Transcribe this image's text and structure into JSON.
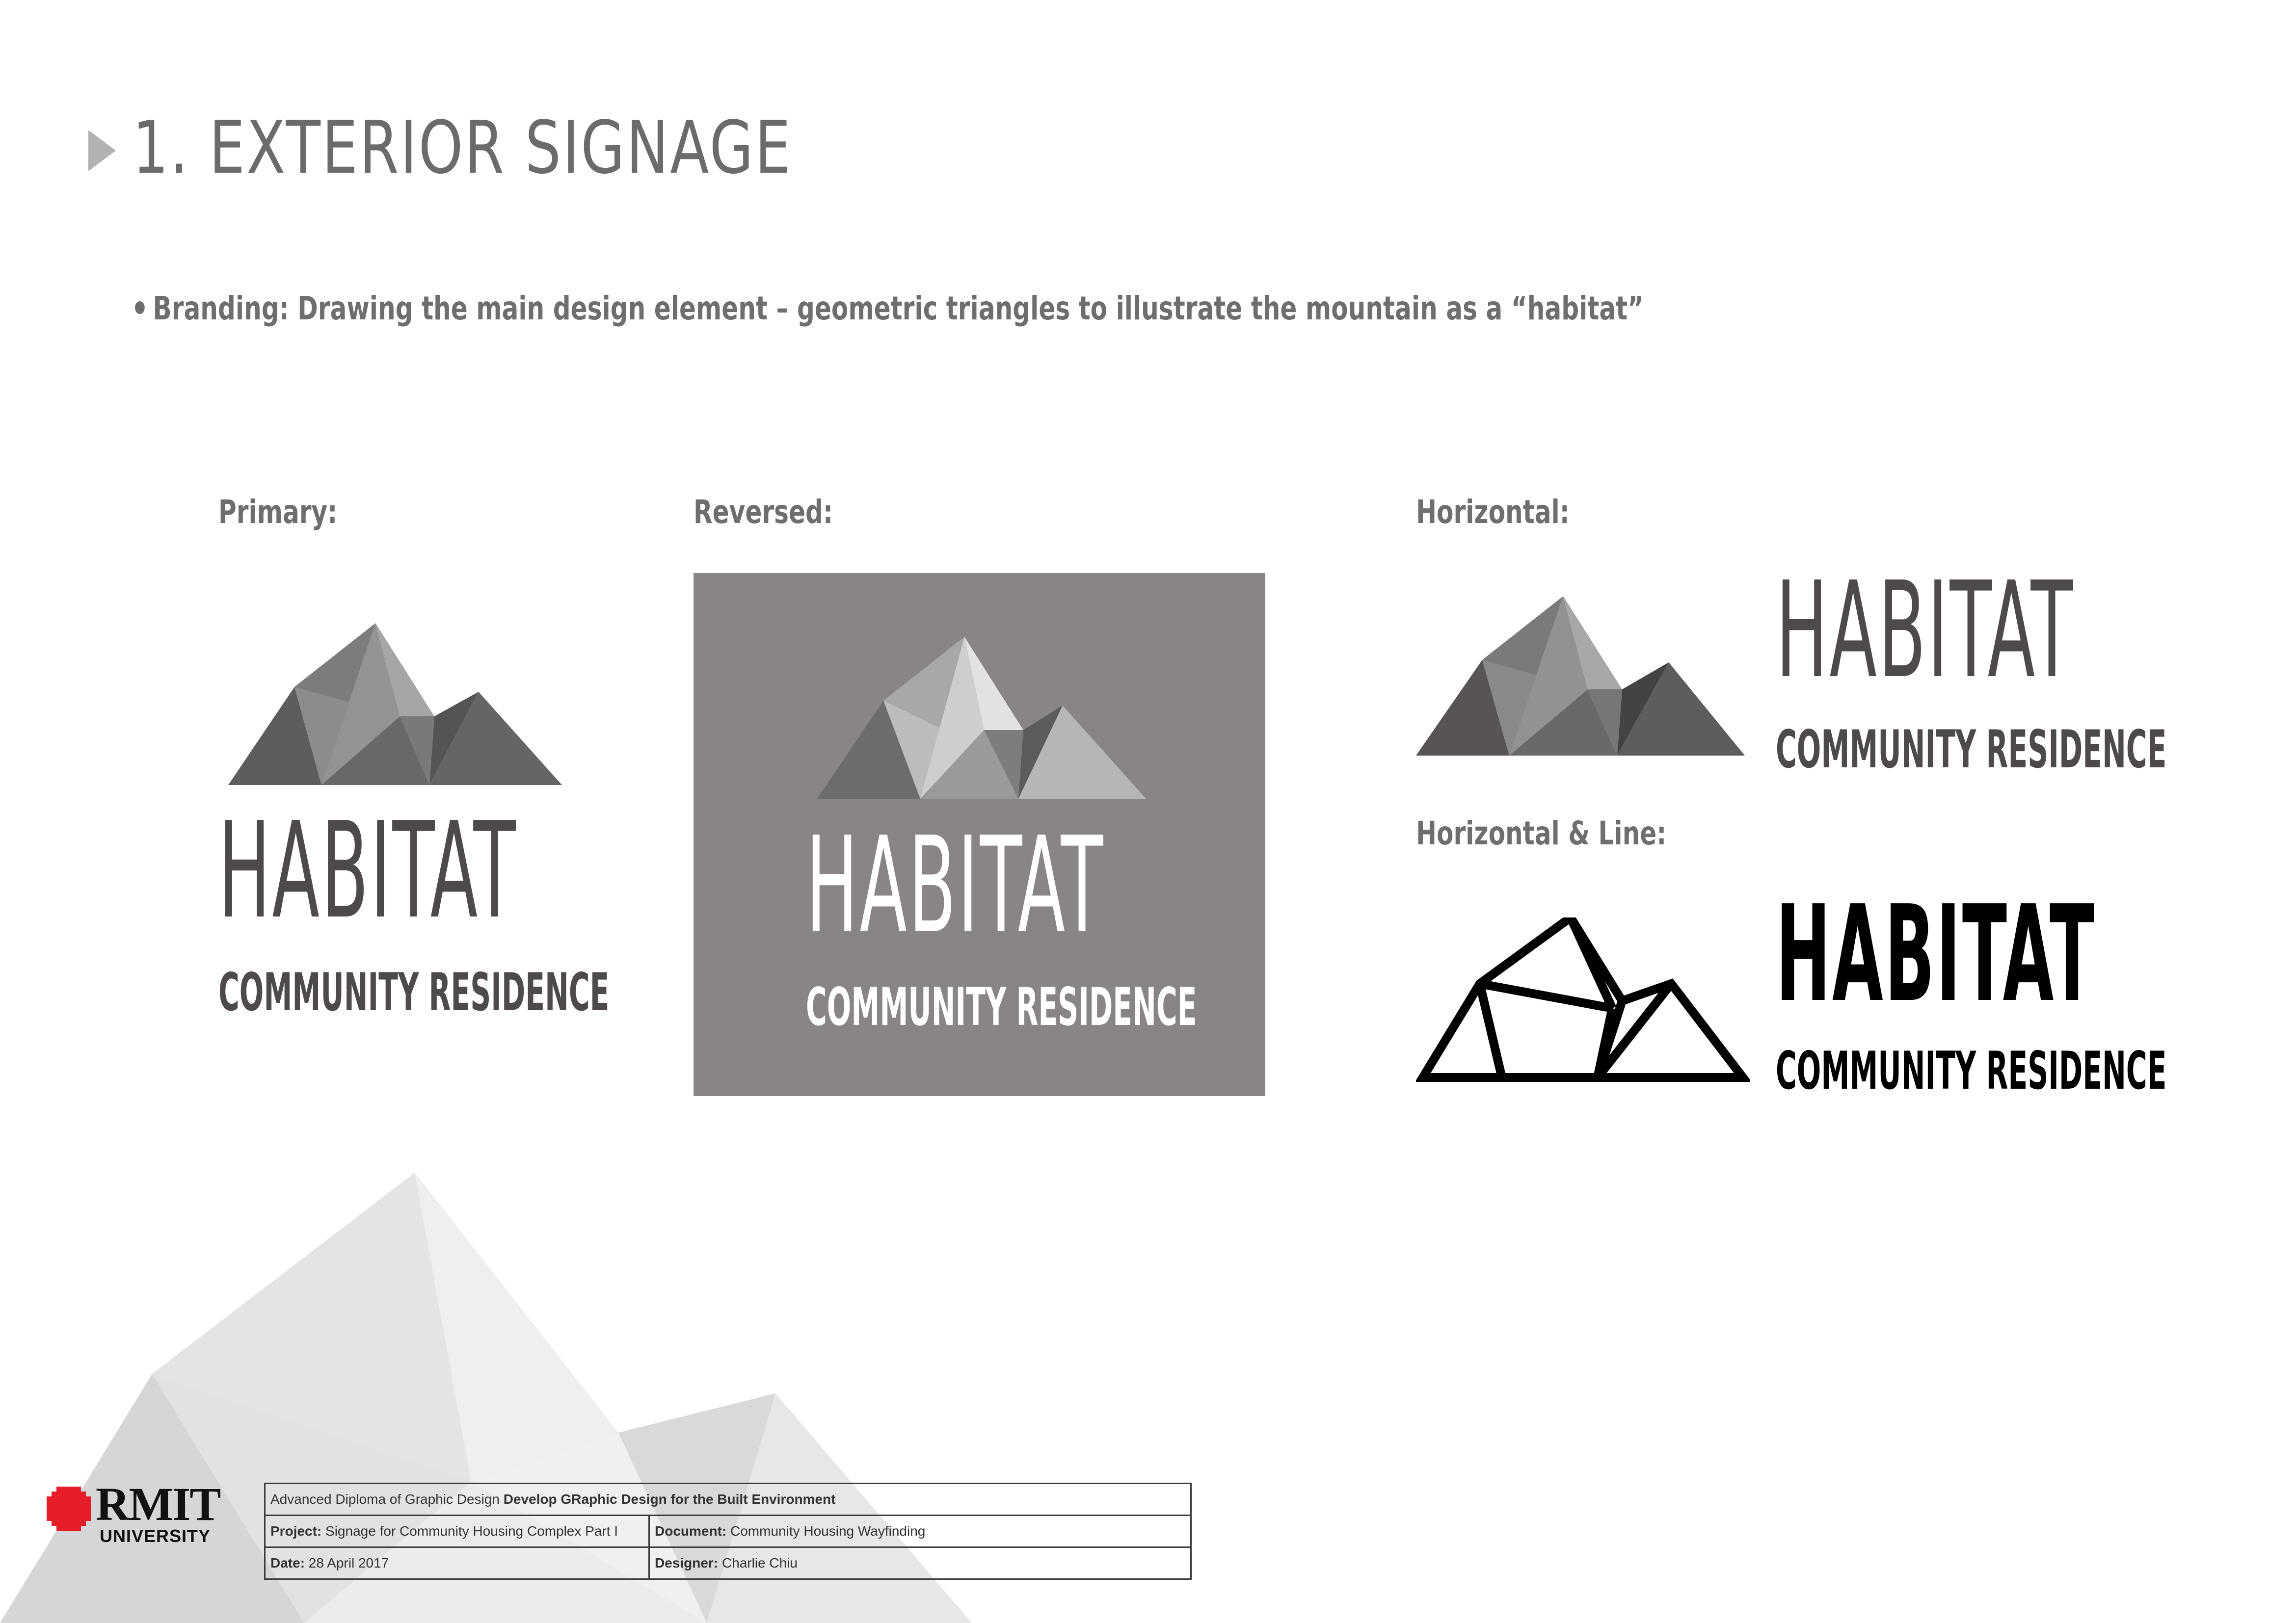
{
  "header": {
    "title": "1. EXTERIOR SIGNAGE",
    "bullet": "Branding: Drawing the main design element  – geometric triangles to illustrate the mountain as a “habitat”"
  },
  "sections": {
    "primary_label": "Primary:",
    "reversed_label": "Reversed:",
    "horizontal_label": "Horizontal:",
    "horizontal_line_label": "Horizontal & Line:"
  },
  "logo": {
    "name": "HABITAT",
    "tagline": "COMMUNITY RESIDENCE"
  },
  "footer": {
    "course_prefix": "Advanced Diploma of Graphic Design",
    "course_bold": "Develop GRaphic Design for the Built Environment",
    "project_label": "Project:",
    "project_value": "Signage for Community Housing Complex Part I",
    "document_label": "Document:",
    "document_value": "Community Housing Wayfinding",
    "date_label": "Date:",
    "date_value": "28 April 2017",
    "designer_label": "Designer:",
    "designer_value": "Charlie Chiu"
  },
  "branding": {
    "university_name": "RMIT",
    "university_sub": "UNIVERSITY"
  },
  "colors": {
    "title_gray": "#6b6b6b",
    "logo_dark": "#4d4a49",
    "reversed_bg": "#888584",
    "rmit_red": "#e61e2a"
  }
}
